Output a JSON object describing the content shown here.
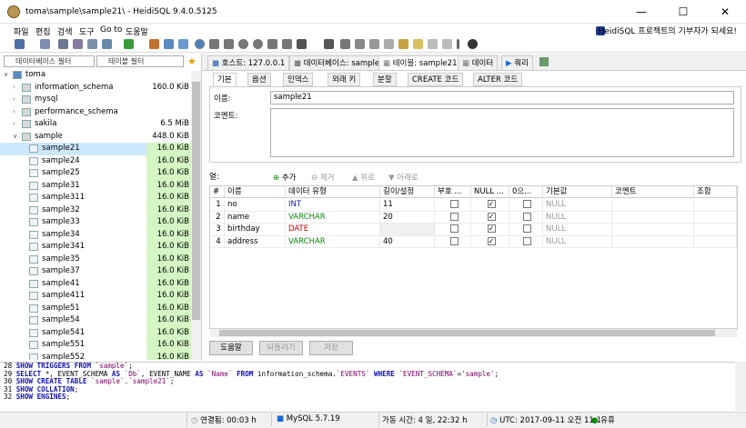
{
  "window": {
    "title": "toma\\sample\\sample21\\ - HeidiSQL 9.4.0.5125",
    "minimize": "—",
    "maximize": "☐",
    "close": "✕"
  },
  "menu": [
    "파일",
    "편집",
    "검색",
    "도구",
    "Go to",
    "도움말"
  ],
  "ad_text": "HeidiSQL 프로젝트의 기부자가 되세요!",
  "filters": {
    "db_placeholder": "데이터베이스 필터",
    "table_placeholder": "테이블 필터"
  },
  "tree": {
    "root": "toma",
    "databases": [
      {
        "name": "information_schema",
        "size": "160.0 KiB"
      },
      {
        "name": "mysql",
        "size": ""
      },
      {
        "name": "performance_schema",
        "size": ""
      },
      {
        "name": "sakila",
        "size": "6.5 MiB"
      },
      {
        "name": "sample",
        "size": "448.0 KiB"
      }
    ],
    "tables": [
      {
        "name": "sample21",
        "size": "16.0 KiB"
      },
      {
        "name": "sample24",
        "size": "16.0 KiB"
      },
      {
        "name": "sample25",
        "size": "16.0 KiB"
      },
      {
        "name": "sample31",
        "size": "16.0 KiB"
      },
      {
        "name": "sample311",
        "size": "16.0 KiB"
      },
      {
        "name": "sample32",
        "size": "16.0 KiB"
      },
      {
        "name": "sample33",
        "size": "16.0 KiB"
      },
      {
        "name": "sample34",
        "size": "16.0 KiB"
      },
      {
        "name": "sample341",
        "size": "16.0 KiB"
      },
      {
        "name": "sample35",
        "size": "16.0 KiB"
      },
      {
        "name": "sample37",
        "size": "16.0 KiB"
      },
      {
        "name": "sample41",
        "size": "16.0 KiB"
      },
      {
        "name": "sample411",
        "size": "16.0 KiB"
      },
      {
        "name": "sample51",
        "size": "16.0 KiB"
      },
      {
        "name": "sample54",
        "size": "16.0 KiB"
      },
      {
        "name": "sample541",
        "size": "16.0 KiB"
      },
      {
        "name": "sample551",
        "size": "16.0 KiB"
      },
      {
        "name": "sample552",
        "size": "16.0 KiB"
      }
    ]
  },
  "main_tabs": [
    "호스트: 127.0.0.1",
    "데이터베이스: sample",
    "테이블: sample21",
    "데이터",
    "쿼리"
  ],
  "sub_tabs": [
    "기본",
    "옵션",
    "인덱스",
    "외래 키",
    "분할",
    "CREATE 코드",
    "ALTER 코드"
  ],
  "form": {
    "name_label": "이름:",
    "name_value": "sample21",
    "comment_label": "코멘트:"
  },
  "columns_bar": {
    "label": "열:",
    "add": "추가",
    "remove": "제거",
    "up": "위로",
    "down": "아래로"
  },
  "grid": {
    "headers": [
      "#",
      "이름",
      "데이터 유형",
      "길이/설정",
      "부호 ...",
      "NULL ...",
      "0으...",
      "기본값",
      "코멘트",
      "조합"
    ],
    "rows": [
      {
        "num": "1",
        "name": "no",
        "type": "INT",
        "length": "11",
        "unsigned": false,
        "nullable": true,
        "zerofill": false,
        "default": "NULL"
      },
      {
        "num": "2",
        "name": "name",
        "type": "VARCHAR",
        "length": "20",
        "unsigned": false,
        "nullable": true,
        "zerofill": false,
        "default": "NULL"
      },
      {
        "num": "3",
        "name": "birthday",
        "type": "DATE",
        "length": "",
        "unsigned": false,
        "nullable": true,
        "zerofill": false,
        "default": "NULL"
      },
      {
        "num": "4",
        "name": "address",
        "type": "VARCHAR",
        "length": "40",
        "unsigned": false,
        "nullable": true,
        "zerofill": false,
        "default": "NULL"
      }
    ]
  },
  "buttons": {
    "help": "도움말",
    "revert": "되돌리기",
    "save": "저장"
  },
  "sql_log": [
    "28 SHOW TRIGGERS FROM `sample`;",
    "29 SELECT *, EVENT_SCHEMA AS `Db`, EVENT_NAME AS `Name` FROM information_schema.`EVENTS` WHERE `EVENT_SCHEMA`='sample';",
    "30 SHOW CREATE TABLE `sample`.`sample21`;",
    "31 SHOW COLLATION;",
    "32 SHOW ENGINES;"
  ],
  "status": {
    "connected": "연결됨: 00:03 h",
    "server": "MySQL 5.7.19",
    "uptime": "가동 시간: 4 일, 22:32 h",
    "utc": "UTC: 2017-09-11 오전 11:1",
    "state": "유휴"
  }
}
